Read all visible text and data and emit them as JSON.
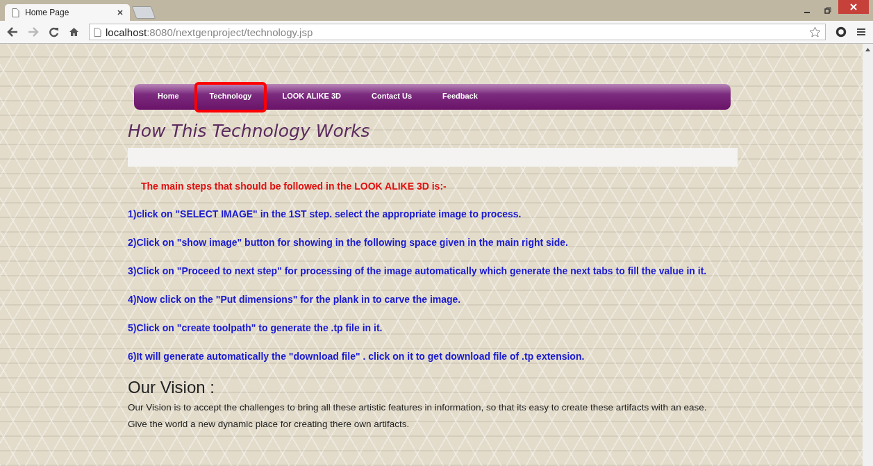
{
  "browser": {
    "tab_title": "Home Page",
    "url_host": "localhost",
    "url_rest": ":8080/nextgenproject/technology.jsp"
  },
  "nav": [
    {
      "label": "Home",
      "selected": false
    },
    {
      "label": "Technology",
      "selected": true
    },
    {
      "label": "LOOK ALIKE 3D",
      "selected": false
    },
    {
      "label": "Contact Us",
      "selected": false
    },
    {
      "label": "Feedback",
      "selected": false
    }
  ],
  "heading": "How This Technology Works",
  "intro": "The main steps that should be followed in the LOOK ALIKE 3D is:-",
  "steps": [
    "1)click on \"SELECT IMAGE\" in the 1ST step. select the appropriate image to process.",
    "2)Click on \"show image\" button for showing in the following space given in the main right side.",
    "3)Click on \"Proceed to next step\" for processing of the image automatically which generate the next tabs to fill the value in it.",
    "4)Now click on the \"Put dimensions\" for the plank in to carve the image.",
    "5)Click on \"create toolpath\" to generate the .tp file in it.",
    "6)It will generate automatically the \"download file\" . click on it to get download file of .tp extension."
  ],
  "vision": {
    "title": "Our Vision :",
    "paragraphs": [
      "Our Vision is to accept the challenges to bring all these artistic features in information, so that its easy to create these artifacts with an ease.",
      "Give the world a new dynamic place for creating there own artifacts."
    ]
  }
}
